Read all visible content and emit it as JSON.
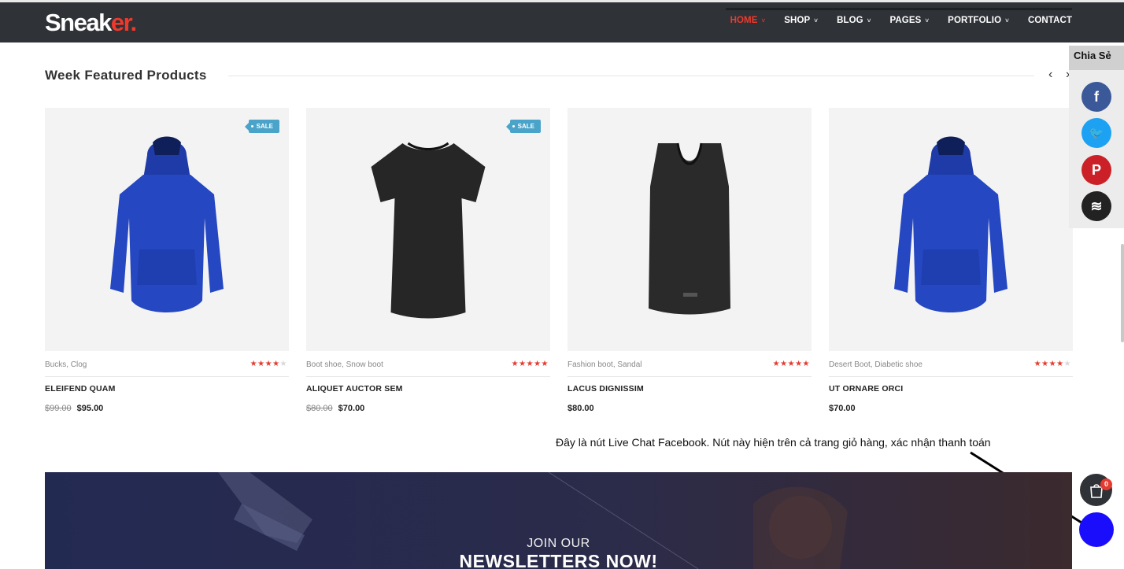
{
  "brand": {
    "logo_main": "Sneak",
    "logo_accent": "er."
  },
  "nav": [
    {
      "label": "HOME",
      "chevron": "˅",
      "active": true
    },
    {
      "label": "SHOP",
      "chevron": "˅"
    },
    {
      "label": "BLOG",
      "chevron": "˅"
    },
    {
      "label": "PAGES",
      "chevron": "˅"
    },
    {
      "label": "PORTFOLIO",
      "chevron": "˅"
    },
    {
      "label": "CONTACT",
      "chevron": ""
    }
  ],
  "section": {
    "title": "Week Featured Products",
    "prev_icon": "‹",
    "next_icon": "›"
  },
  "products": [
    {
      "badge": "SALE",
      "categories": "Bucks, Clog",
      "rating": 4,
      "name": "ELEIFEND QUAM",
      "old_price": "$99.00",
      "price": "$95.00",
      "garment": "blue-hoodie"
    },
    {
      "badge": "SALE",
      "categories": "Boot shoe, Snow boot",
      "rating": 5,
      "name": "ALIQUET AUCTOR SEM",
      "old_price": "$80.00",
      "price": "$70.00",
      "garment": "black-tshirt"
    },
    {
      "badge": "",
      "categories": "Fashion boot, Sandal",
      "rating": 5,
      "name": "LACUS DIGNISSIM",
      "old_price": "",
      "price": "$80.00",
      "garment": "black-tank"
    },
    {
      "badge": "",
      "categories": "Desert Boot, Diabetic shoe",
      "rating": 4,
      "name": "UT ORNARE ORCI",
      "old_price": "",
      "price": "$70.00",
      "garment": "blue-hoodie"
    }
  ],
  "share": {
    "title": "Chia Sẻ",
    "buttons": [
      {
        "icon": "facebook-icon",
        "glyph": "f",
        "color": "#3b5998"
      },
      {
        "icon": "twitter-icon",
        "glyph": "🐦",
        "color": "#1da1f2"
      },
      {
        "icon": "pinterest-icon",
        "glyph": "P",
        "color": "#cb2027"
      },
      {
        "icon": "buffer-icon",
        "glyph": "≋",
        "color": "#222222"
      }
    ]
  },
  "annotation": "Đây là nút Live Chat Facebook. Nút này  hiện trên cả trang giỏ hàng, xác nhận thanh toán",
  "newsletter": {
    "subtitle": "JOIN OUR",
    "title": "NEWSLETTERS NOW!"
  },
  "cart": {
    "count": "0"
  },
  "colors": {
    "accent": "#f0392b",
    "header": "#2f3237",
    "badge": "#4aa3c9",
    "chat": "#1a0dfc"
  }
}
